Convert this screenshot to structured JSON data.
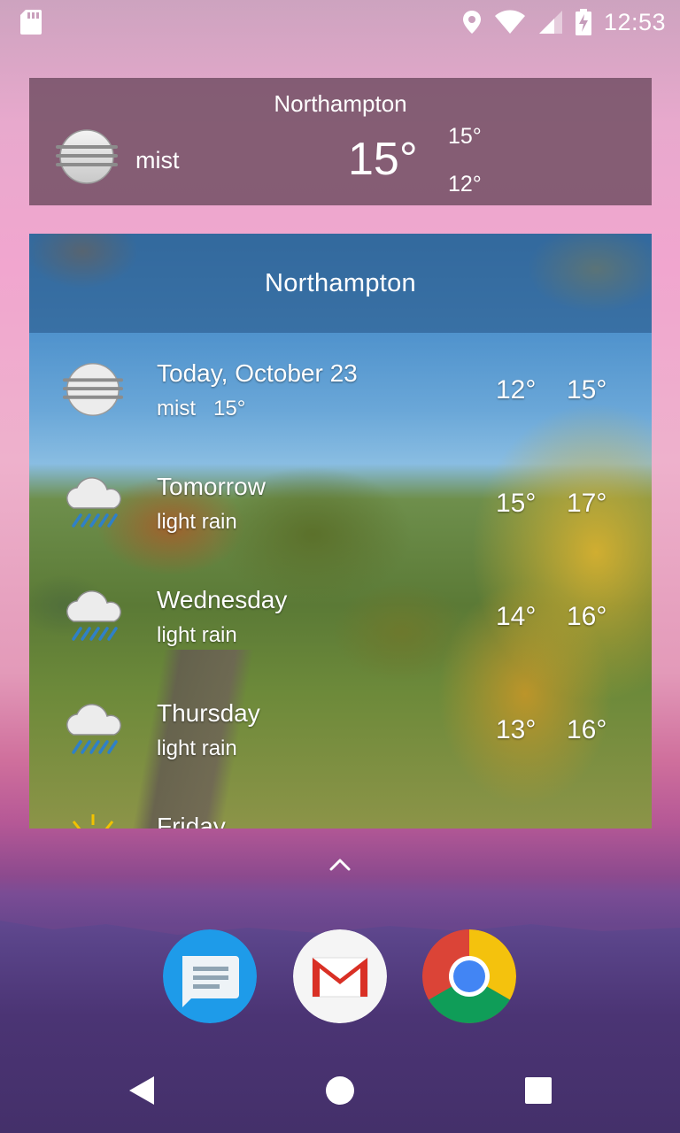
{
  "status_bar": {
    "time": "12:53",
    "icons": [
      "sd-card-icon",
      "location-icon",
      "wifi-icon",
      "signal-icon",
      "battery-charging-icon"
    ]
  },
  "current_widget": {
    "city": "Northampton",
    "condition": "mist",
    "condition_icon": "mist-icon",
    "temperature": "15°",
    "high": "15°",
    "low": "12°"
  },
  "forecast_widget": {
    "city": "Northampton",
    "days": [
      {
        "day": "Today, October 23",
        "condition": "mist",
        "current": "15°",
        "low": "12°",
        "high": "15°",
        "icon": "mist-icon"
      },
      {
        "day": "Tomorrow",
        "condition": "light rain",
        "low": "15°",
        "high": "17°",
        "icon": "light-rain-icon"
      },
      {
        "day": "Wednesday",
        "condition": "light rain",
        "low": "14°",
        "high": "16°",
        "icon": "light-rain-icon"
      },
      {
        "day": "Thursday",
        "condition": "light rain",
        "low": "13°",
        "high": "16°",
        "icon": "light-rain-icon"
      },
      {
        "day": "Friday",
        "icon": "sun-icon"
      }
    ]
  },
  "dock": {
    "apps": [
      {
        "name": "Messages",
        "icon": "messages-icon",
        "color": "#1e9be9"
      },
      {
        "name": "Gmail",
        "icon": "gmail-icon",
        "color": "#d93025"
      },
      {
        "name": "Chrome",
        "icon": "chrome-icon",
        "color": "#4285f4"
      }
    ]
  },
  "nav_bar": {
    "buttons": [
      "back-icon",
      "home-icon",
      "recents-icon"
    ]
  }
}
